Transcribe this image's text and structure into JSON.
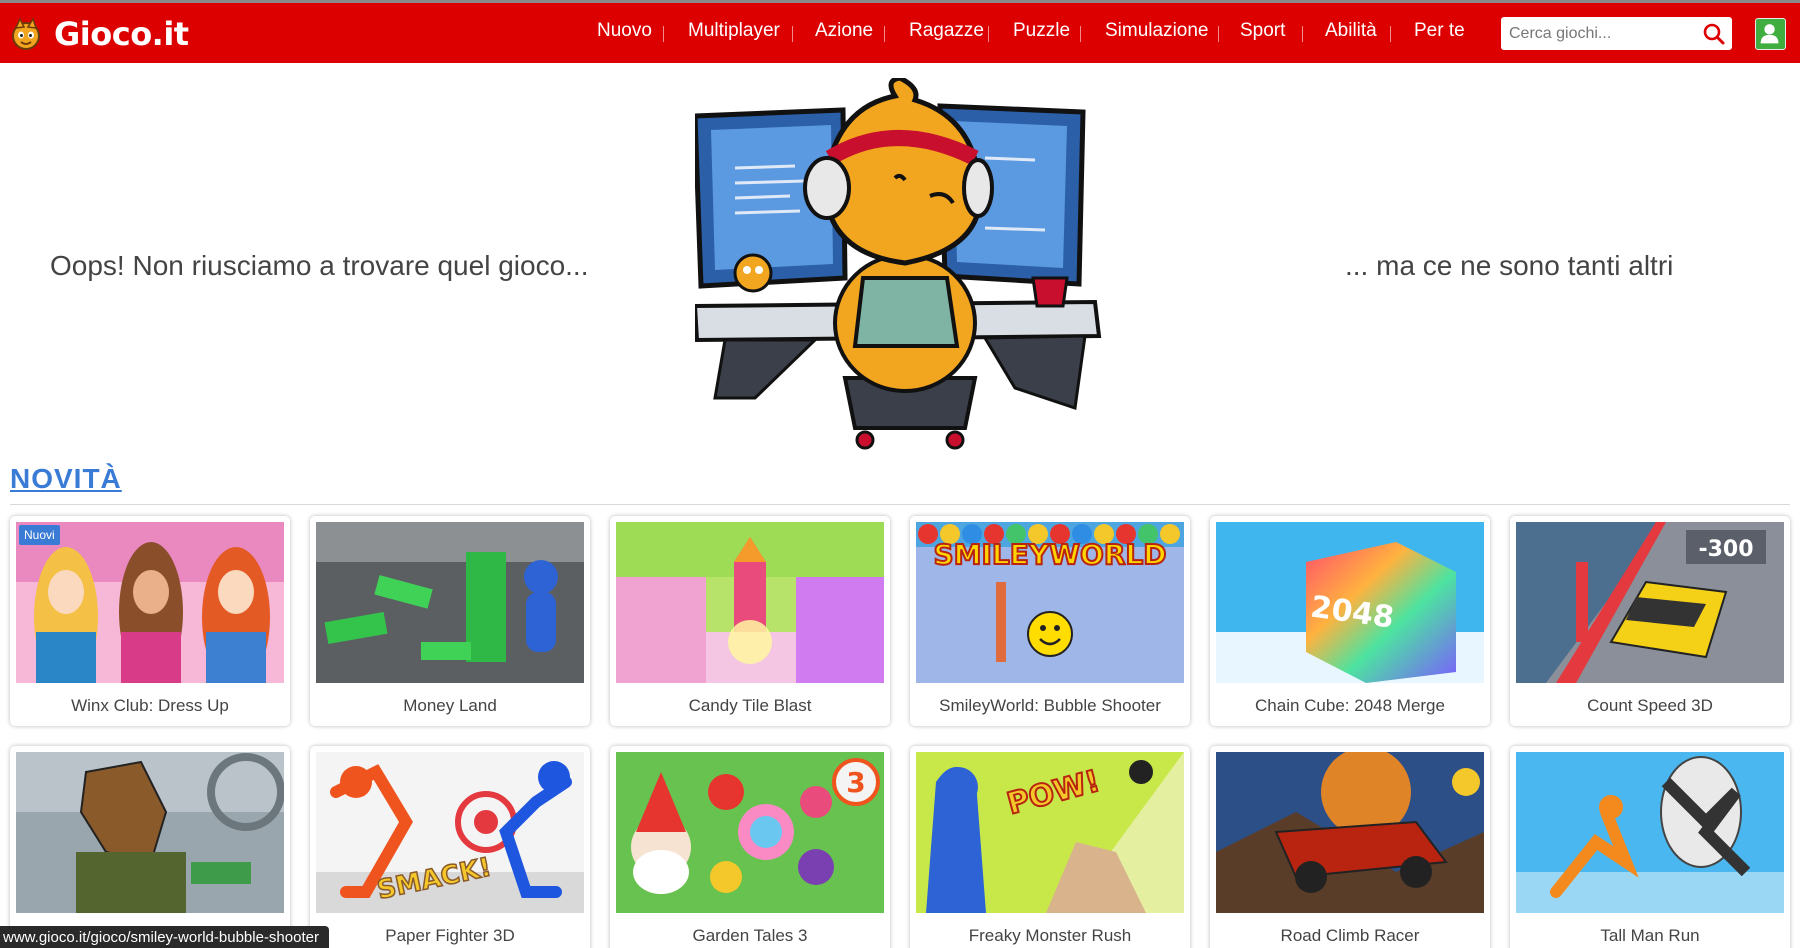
{
  "header": {
    "logo_text": "Gioco.it",
    "nav": [
      "Nuovo",
      "Multiplayer",
      "Azione",
      "Ragazze",
      "Puzzle",
      "Simulazione",
      "Sport",
      "Abilità",
      "Per te"
    ],
    "search_placeholder": "Cerca giochi...",
    "search_icon": "search-icon",
    "user_icon": "user-icon"
  },
  "hero": {
    "left_text": "Oops! Non riusciamo a trovare quel gioco...",
    "right_text": "... ma ce ne sono tanti altri"
  },
  "section": {
    "title": "NOVITÀ",
    "new_badge": "Nuovi"
  },
  "games": [
    {
      "title": "Winx Club: Dress Up",
      "badge": true
    },
    {
      "title": "Money Land"
    },
    {
      "title": "Candy Tile Blast"
    },
    {
      "title": "SmileyWorld: Bubble Shooter",
      "thumb_text": "SMILEYWORLD"
    },
    {
      "title": "Chain Cube: 2048 Merge",
      "thumb_text": "2048"
    },
    {
      "title": "Count Speed 3D",
      "thumb_text": "-300"
    },
    {
      "title": ""
    },
    {
      "title": "Paper Fighter 3D",
      "thumb_text": "SMACK!"
    },
    {
      "title": "Garden Tales 3",
      "thumb_text": "3"
    },
    {
      "title": "Freaky Monster Rush",
      "thumb_text": "POW!"
    },
    {
      "title": "Road Climb Racer"
    },
    {
      "title": "Tall Man Run"
    }
  ],
  "status_url": "www.gioco.it/gioco/smiley-world-bubble-shooter",
  "colors": {
    "header_red": "#dd0000",
    "link_blue": "#3a7bd5",
    "user_green": "#3fae3f"
  }
}
